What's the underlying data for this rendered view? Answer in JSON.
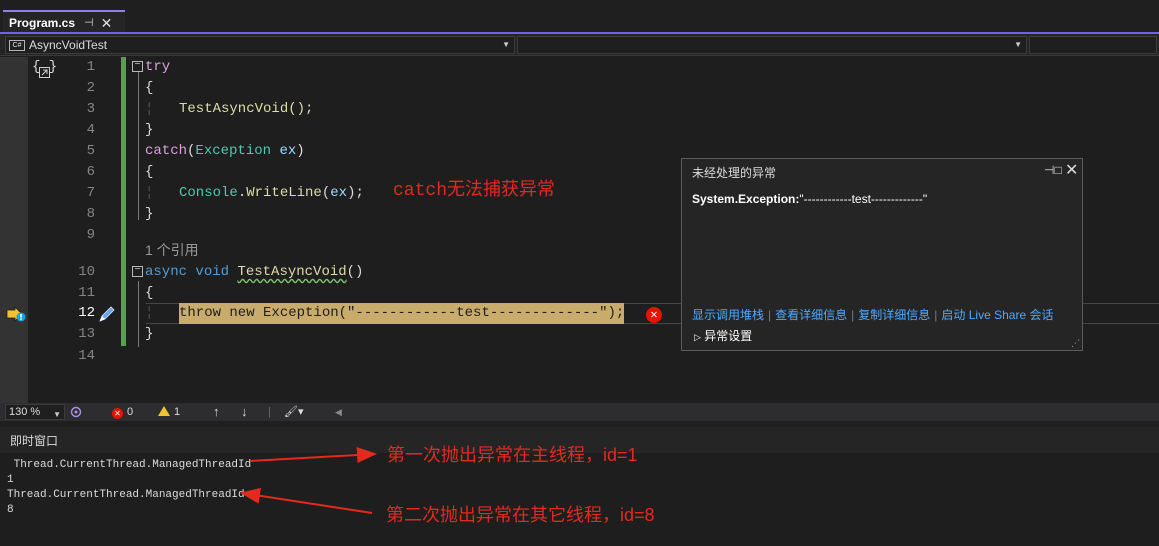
{
  "tab": {
    "label": "Program.cs",
    "pin": "⊣",
    "close": "✕"
  },
  "nav": {
    "project_badge": "C#",
    "project": "AsyncVoidTest",
    "member": "",
    "extra": ""
  },
  "editor": {
    "lines": [
      {
        "n": "1",
        "code": "try"
      },
      {
        "n": "2",
        "code": "{"
      },
      {
        "n": "3",
        "code": "TestAsyncVoid();"
      },
      {
        "n": "4",
        "code": "}"
      },
      {
        "n": "5",
        "code": "catch(Exception ex)"
      },
      {
        "n": "6",
        "code": "{"
      },
      {
        "n": "7",
        "code": "Console.WriteLine(ex);"
      },
      {
        "n": "8",
        "code": "}"
      },
      {
        "n": "9",
        "code": ""
      },
      {
        "n": "10",
        "code": "async void TestAsyncVoid()"
      },
      {
        "n": "11",
        "code": "{"
      },
      {
        "n": "12",
        "code": "throw new Exception(\"------------test-------------\");"
      },
      {
        "n": "13",
        "code": "}"
      },
      {
        "n": "14",
        "code": ""
      }
    ],
    "codelens": "1 个引用",
    "braces_glyph": "{ }",
    "annotation": "catch无法捕获异常"
  },
  "exception_helper": {
    "title": "未经处理的异常",
    "exception_type": "System.Exception:",
    "message": "\"------------test-------------\"",
    "links": [
      "显示调用堆栈",
      "查看详细信息",
      "复制详细信息",
      "启动 Live Share 会话"
    ],
    "settings": "异常设置"
  },
  "status": {
    "zoom": "130 %",
    "errors": "0",
    "warnings": "1"
  },
  "immediate": {
    "title": "即时窗口",
    "lines": [
      " Thread.CurrentThread.ManagedThreadId",
      "1",
      "Thread.CurrentThread.ManagedThreadId",
      "8"
    ],
    "annotations": [
      "第一次抛出异常在主线程，id=1",
      "第二次抛出异常在其它线程，id=8"
    ]
  },
  "colors": {
    "accent": "#7160e8",
    "error": "#e51400",
    "annotation": "#e32a1f",
    "change_bar": "#4ea84a"
  }
}
